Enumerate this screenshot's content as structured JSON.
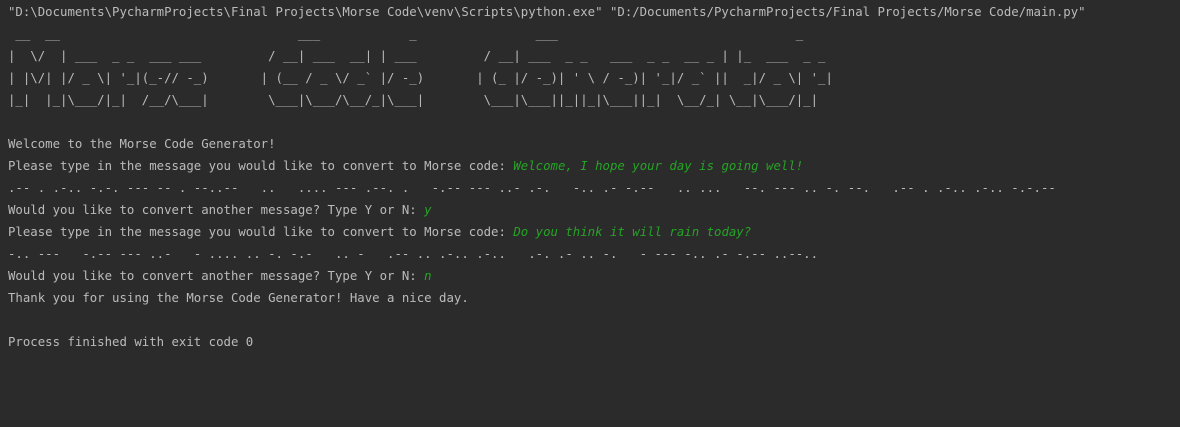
{
  "console": {
    "command": "\"D:\\Documents\\PycharmProjects\\Final Projects\\Morse Code\\venv\\Scripts\\python.exe\" \"D:/Documents/PycharmProjects/Final Projects/Morse Code/main.py\"",
    "banner": [
      " __  __                                ___            _                ___                                _",
      "|  \\/  | ___  _ _  ___ ___         / __| ___  __| | ___         / __| ___  _ _   ___  _ _  __ _ | |_  ___  _ _",
      "| |\\/| |/ _ \\| '_|(_-// -_)       | (__ / _ \\/ _` |/ -_)       | (_ |/ -_)| ' \\ / -_)| '_|/ _` ||  _|/ _ \\| '_|",
      "|_|  |_|\\___/|_|  /__/\\___|        \\___|\\___/\\__/_|\\___|        \\___|\\___||_||_|\\___||_|  \\__/_| \\__|\\___/|_|"
    ],
    "welcome": "Welcome to the Morse Code Generator!",
    "prompt_message": "Please type in the message you would like to convert to Morse code: ",
    "input_1": "Welcome, I hope your day is going well!",
    "morse_1": ".-- . .-.. -.-. --- -- . --..--   ..   .... --- .--. .   -.-- --- ..- .-.   -.. .- -.--   .. ...   --. --- .. -. --.   .-- . .-.. .-.. -.-.--",
    "prompt_again": "Would you like to convert another message? Type Y or N: ",
    "answer_1": "y",
    "input_2": "Do you think it will rain today?",
    "morse_2": "-.. ---   -.-- --- ..-   - .... .. -. -.-   .. -   .-- .. .-.. .-..   .-. .- .. -.   - --- -.. .- -.-- ..--..",
    "answer_2": "n",
    "goodbye": "Thank you for using the Morse Code Generator! Have a nice day.",
    "exit_message": "Process finished with exit code 0"
  },
  "colors": {
    "background": "#2b2b2b",
    "output_text": "#bbbbbb",
    "user_input": "#26a326"
  }
}
